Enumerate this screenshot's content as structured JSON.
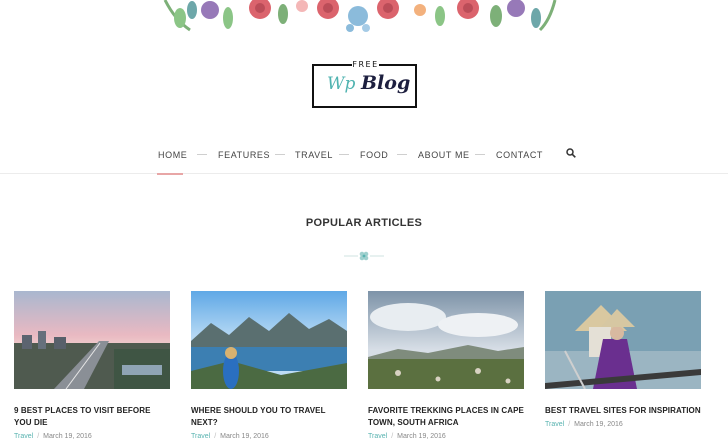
{
  "logo": {
    "free": "FREE",
    "wp": "Wp",
    "blog": "Blog"
  },
  "nav": {
    "items": [
      {
        "label": "HOME"
      },
      {
        "label": "FEATURES"
      },
      {
        "label": "TRAVEL"
      },
      {
        "label": "FOOD"
      },
      {
        "label": "ABOUT ME"
      },
      {
        "label": "CONTACT"
      }
    ],
    "active": "HOME",
    "search_icon": "search-icon"
  },
  "section": {
    "title": "POPULAR ARTICLES"
  },
  "articles": [
    {
      "title": "9 BEST PLACES TO VISIT BEFORE YOU DIE",
      "category": "Travel",
      "date": "March 19, 2016"
    },
    {
      "title": "WHERE SHOULD YOU TO TRAVEL NEXT?",
      "category": "Travel",
      "date": "March 19, 2016"
    },
    {
      "title": "FAVORITE TREKKING PLACES IN CAPE TOWN, SOUTH AFRICA",
      "category": "Travel",
      "date": "March 19, 2016"
    },
    {
      "title": "BEST TRAVEL SITES FOR INSPIRATION",
      "category": "Travel",
      "date": "March 19, 2016"
    }
  ],
  "colors": {
    "accent": "#58b3b0",
    "nav_active": "#e8a6a6",
    "text": "#333333"
  }
}
